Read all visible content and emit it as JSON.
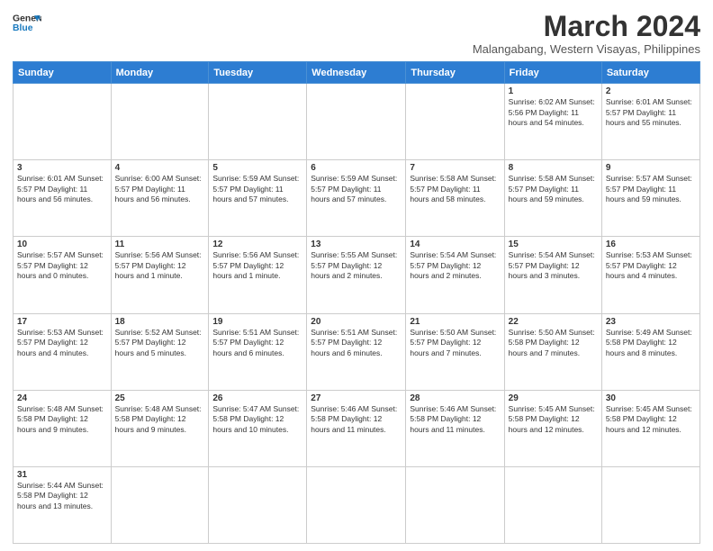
{
  "header": {
    "logo_line1": "General",
    "logo_line2": "Blue",
    "title": "March 2024",
    "location": "Malangabang, Western Visayas, Philippines"
  },
  "days_of_week": [
    "Sunday",
    "Monday",
    "Tuesday",
    "Wednesday",
    "Thursday",
    "Friday",
    "Saturday"
  ],
  "weeks": [
    [
      {
        "day": "",
        "info": ""
      },
      {
        "day": "",
        "info": ""
      },
      {
        "day": "",
        "info": ""
      },
      {
        "day": "",
        "info": ""
      },
      {
        "day": "",
        "info": ""
      },
      {
        "day": "1",
        "info": "Sunrise: 6:02 AM\nSunset: 5:56 PM\nDaylight: 11 hours\nand 54 minutes."
      },
      {
        "day": "2",
        "info": "Sunrise: 6:01 AM\nSunset: 5:57 PM\nDaylight: 11 hours\nand 55 minutes."
      }
    ],
    [
      {
        "day": "3",
        "info": "Sunrise: 6:01 AM\nSunset: 5:57 PM\nDaylight: 11 hours\nand 56 minutes."
      },
      {
        "day": "4",
        "info": "Sunrise: 6:00 AM\nSunset: 5:57 PM\nDaylight: 11 hours\nand 56 minutes."
      },
      {
        "day": "5",
        "info": "Sunrise: 5:59 AM\nSunset: 5:57 PM\nDaylight: 11 hours\nand 57 minutes."
      },
      {
        "day": "6",
        "info": "Sunrise: 5:59 AM\nSunset: 5:57 PM\nDaylight: 11 hours\nand 57 minutes."
      },
      {
        "day": "7",
        "info": "Sunrise: 5:58 AM\nSunset: 5:57 PM\nDaylight: 11 hours\nand 58 minutes."
      },
      {
        "day": "8",
        "info": "Sunrise: 5:58 AM\nSunset: 5:57 PM\nDaylight: 11 hours\nand 59 minutes."
      },
      {
        "day": "9",
        "info": "Sunrise: 5:57 AM\nSunset: 5:57 PM\nDaylight: 11 hours\nand 59 minutes."
      }
    ],
    [
      {
        "day": "10",
        "info": "Sunrise: 5:57 AM\nSunset: 5:57 PM\nDaylight: 12 hours\nand 0 minutes."
      },
      {
        "day": "11",
        "info": "Sunrise: 5:56 AM\nSunset: 5:57 PM\nDaylight: 12 hours\nand 1 minute."
      },
      {
        "day": "12",
        "info": "Sunrise: 5:56 AM\nSunset: 5:57 PM\nDaylight: 12 hours\nand 1 minute."
      },
      {
        "day": "13",
        "info": "Sunrise: 5:55 AM\nSunset: 5:57 PM\nDaylight: 12 hours\nand 2 minutes."
      },
      {
        "day": "14",
        "info": "Sunrise: 5:54 AM\nSunset: 5:57 PM\nDaylight: 12 hours\nand 2 minutes."
      },
      {
        "day": "15",
        "info": "Sunrise: 5:54 AM\nSunset: 5:57 PM\nDaylight: 12 hours\nand 3 minutes."
      },
      {
        "day": "16",
        "info": "Sunrise: 5:53 AM\nSunset: 5:57 PM\nDaylight: 12 hours\nand 4 minutes."
      }
    ],
    [
      {
        "day": "17",
        "info": "Sunrise: 5:53 AM\nSunset: 5:57 PM\nDaylight: 12 hours\nand 4 minutes."
      },
      {
        "day": "18",
        "info": "Sunrise: 5:52 AM\nSunset: 5:57 PM\nDaylight: 12 hours\nand 5 minutes."
      },
      {
        "day": "19",
        "info": "Sunrise: 5:51 AM\nSunset: 5:57 PM\nDaylight: 12 hours\nand 6 minutes."
      },
      {
        "day": "20",
        "info": "Sunrise: 5:51 AM\nSunset: 5:57 PM\nDaylight: 12 hours\nand 6 minutes."
      },
      {
        "day": "21",
        "info": "Sunrise: 5:50 AM\nSunset: 5:57 PM\nDaylight: 12 hours\nand 7 minutes."
      },
      {
        "day": "22",
        "info": "Sunrise: 5:50 AM\nSunset: 5:58 PM\nDaylight: 12 hours\nand 7 minutes."
      },
      {
        "day": "23",
        "info": "Sunrise: 5:49 AM\nSunset: 5:58 PM\nDaylight: 12 hours\nand 8 minutes."
      }
    ],
    [
      {
        "day": "24",
        "info": "Sunrise: 5:48 AM\nSunset: 5:58 PM\nDaylight: 12 hours\nand 9 minutes."
      },
      {
        "day": "25",
        "info": "Sunrise: 5:48 AM\nSunset: 5:58 PM\nDaylight: 12 hours\nand 9 minutes."
      },
      {
        "day": "26",
        "info": "Sunrise: 5:47 AM\nSunset: 5:58 PM\nDaylight: 12 hours\nand 10 minutes."
      },
      {
        "day": "27",
        "info": "Sunrise: 5:46 AM\nSunset: 5:58 PM\nDaylight: 12 hours\nand 11 minutes."
      },
      {
        "day": "28",
        "info": "Sunrise: 5:46 AM\nSunset: 5:58 PM\nDaylight: 12 hours\nand 11 minutes."
      },
      {
        "day": "29",
        "info": "Sunrise: 5:45 AM\nSunset: 5:58 PM\nDaylight: 12 hours\nand 12 minutes."
      },
      {
        "day": "30",
        "info": "Sunrise: 5:45 AM\nSunset: 5:58 PM\nDaylight: 12 hours\nand 12 minutes."
      }
    ],
    [
      {
        "day": "31",
        "info": "Sunrise: 5:44 AM\nSunset: 5:58 PM\nDaylight: 12 hours\nand 13 minutes."
      },
      {
        "day": "",
        "info": ""
      },
      {
        "day": "",
        "info": ""
      },
      {
        "day": "",
        "info": ""
      },
      {
        "day": "",
        "info": ""
      },
      {
        "day": "",
        "info": ""
      },
      {
        "day": "",
        "info": ""
      }
    ]
  ]
}
